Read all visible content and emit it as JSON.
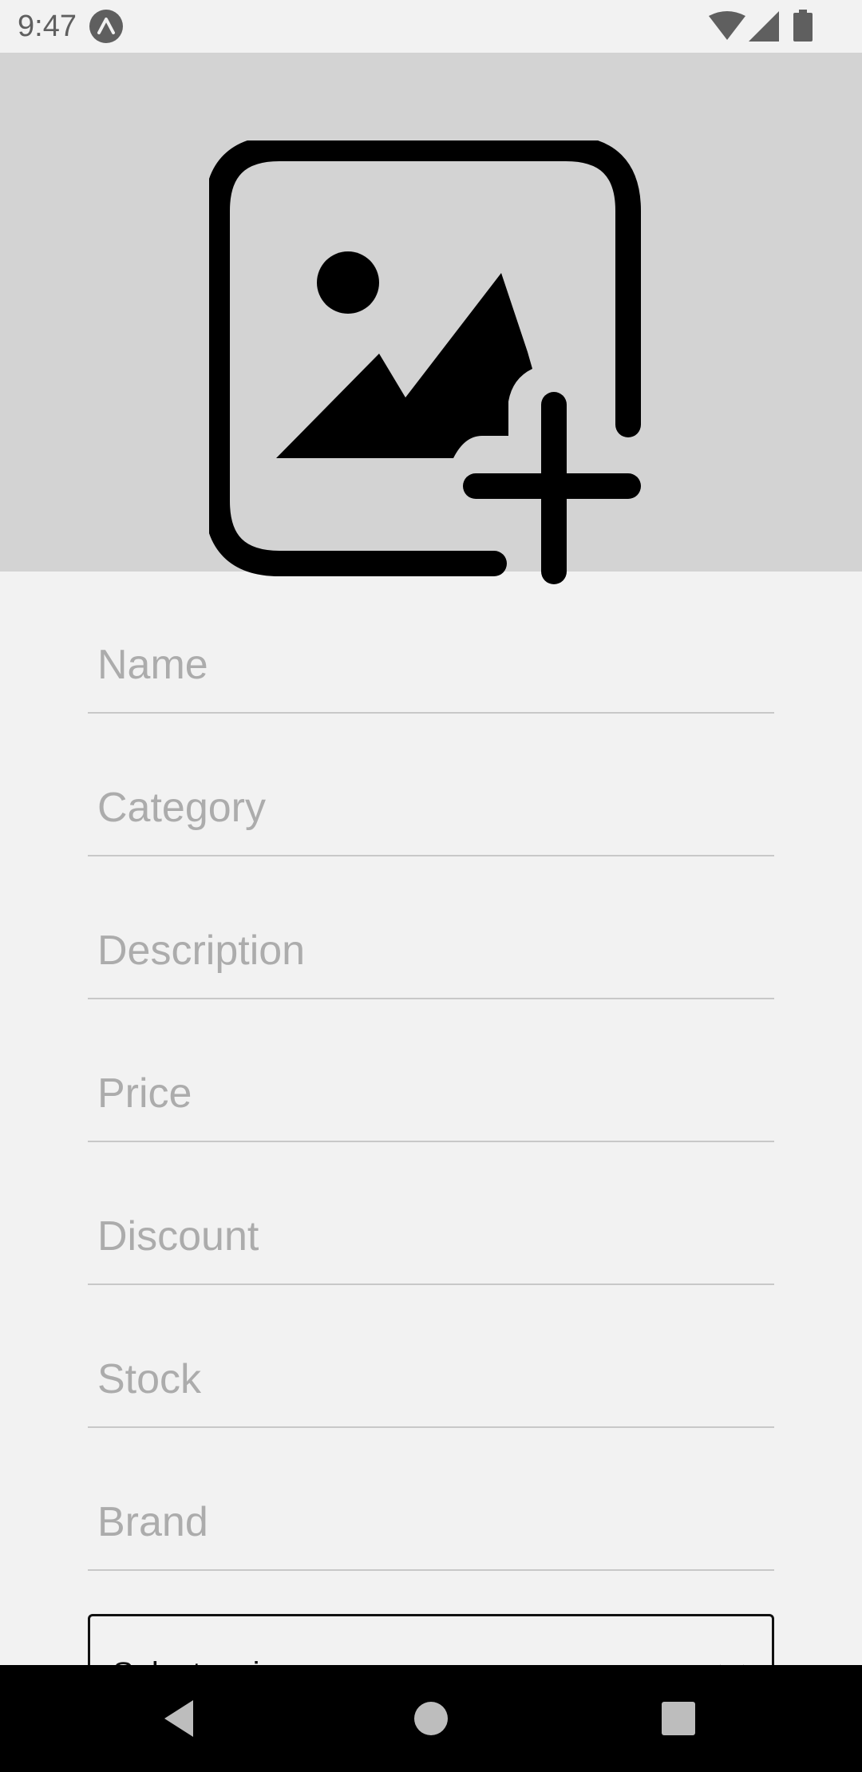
{
  "status_bar": {
    "time": "9:47",
    "app_icon": "expo-icon",
    "icons": [
      "wifi-icon",
      "cell-signal-icon",
      "battery-icon"
    ]
  },
  "image_picker": {
    "icon": "add-photo-icon"
  },
  "form": {
    "fields": [
      {
        "placeholder": "Name",
        "value": ""
      },
      {
        "placeholder": "Category",
        "value": ""
      },
      {
        "placeholder": "Description",
        "value": ""
      },
      {
        "placeholder": "Price",
        "value": ""
      },
      {
        "placeholder": "Discount",
        "value": ""
      },
      {
        "placeholder": "Stock",
        "value": ""
      },
      {
        "placeholder": "Brand",
        "value": ""
      }
    ],
    "size_select": {
      "selected": "Select a size",
      "icon": "chevron-down-icon"
    }
  },
  "nav_bar": {
    "icons": [
      "back-icon",
      "home-icon",
      "recents-icon"
    ]
  },
  "colors": {
    "background": "#f2f2f2",
    "image_picker_bg": "#d3d3d3",
    "placeholder": "#acacac",
    "underline": "#c8c8c8",
    "nav_bar": "#000000"
  }
}
